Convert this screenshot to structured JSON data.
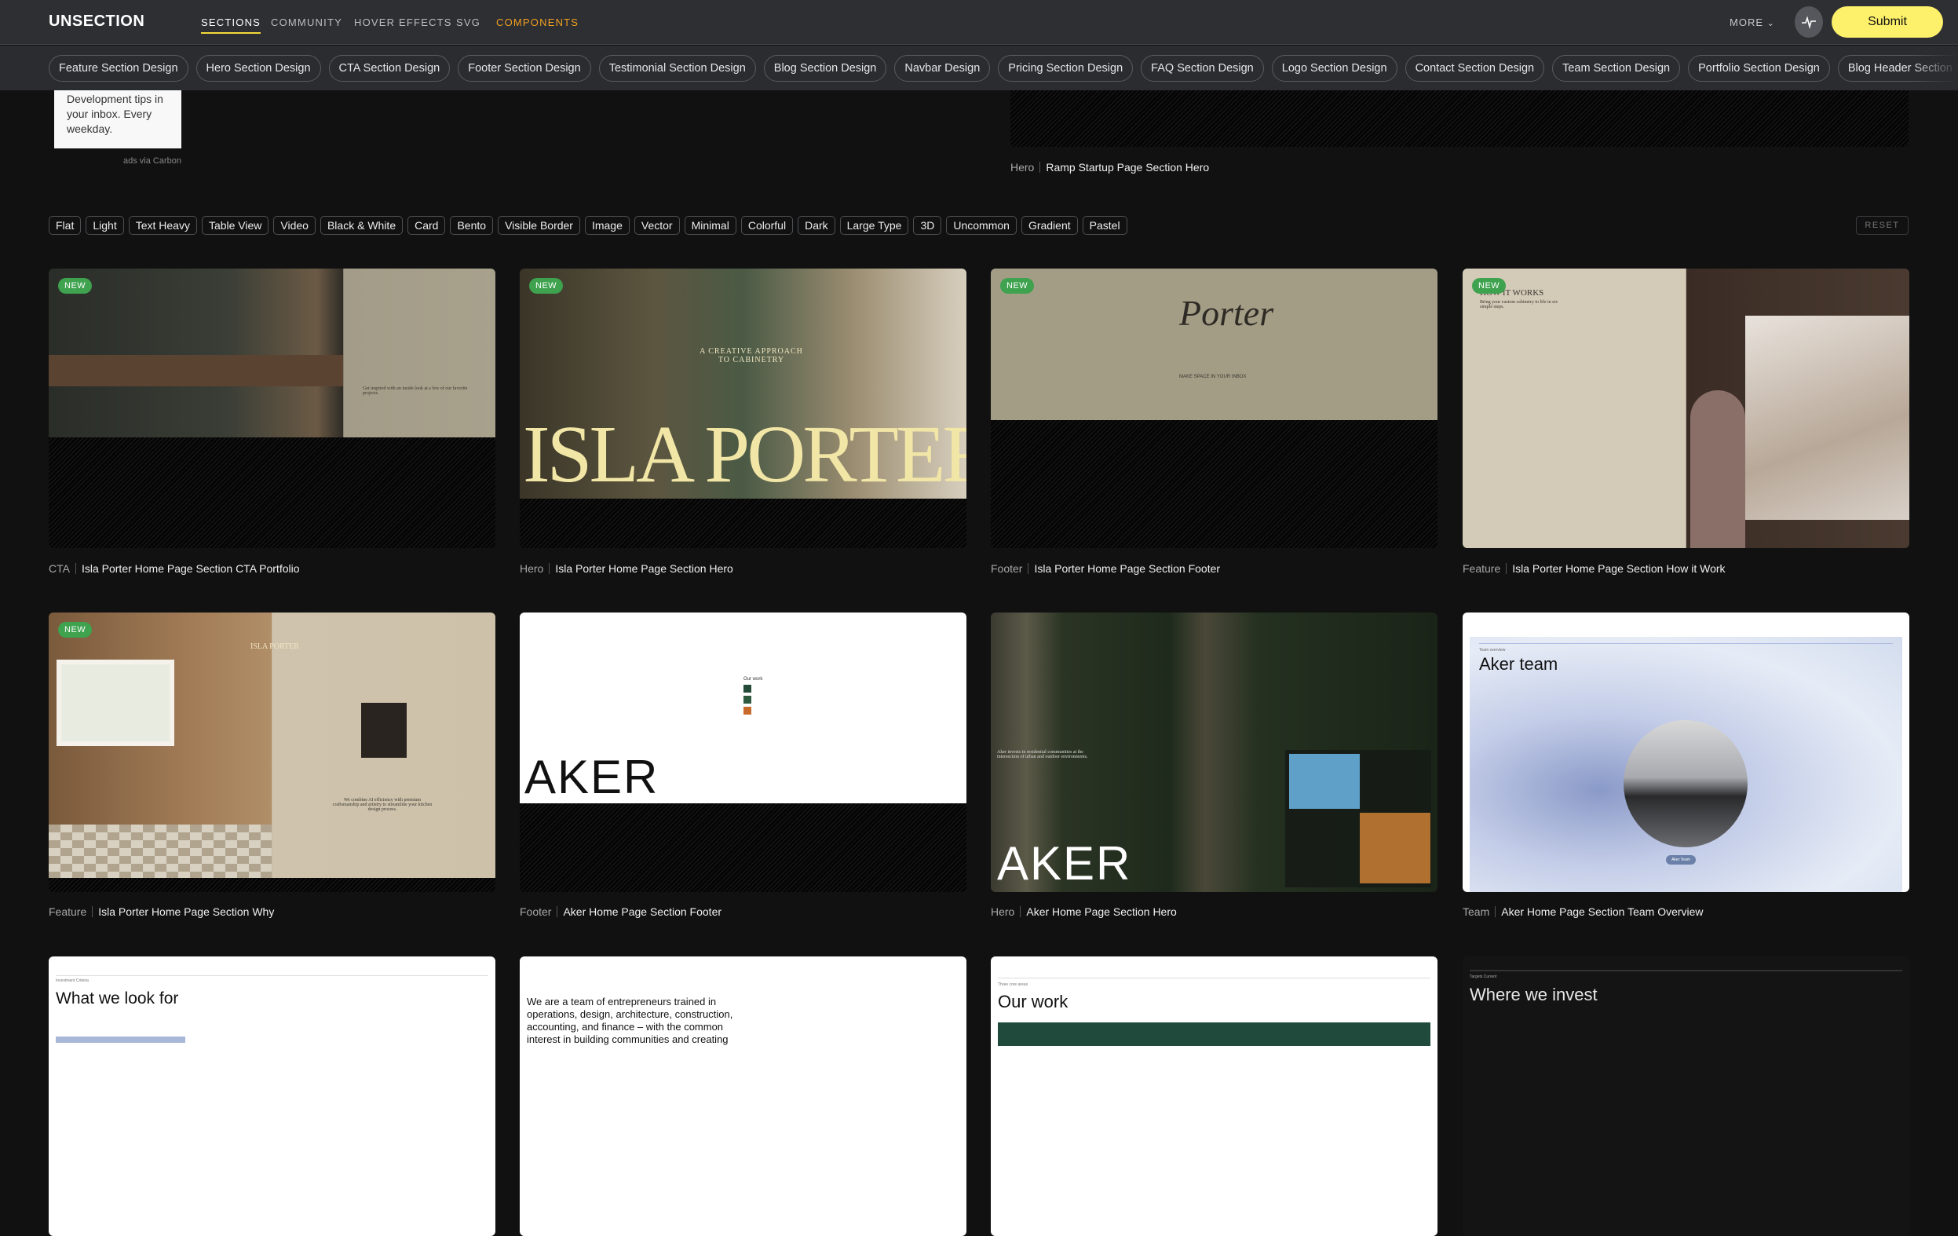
{
  "header": {
    "logo": "UNSECTION",
    "nav": [
      {
        "label": "SECTIONS",
        "active": true
      },
      {
        "label": "COMMUNITY"
      },
      {
        "label": "HOVER EFFECTS"
      },
      {
        "label": "SVG"
      },
      {
        "label": "COMPONENTS",
        "color": "#f0a020"
      }
    ],
    "more_label": "MORE",
    "activity_icon": "pulse-icon",
    "submit_label": "Submit",
    "submit_color": "#fdf06a"
  },
  "categories": [
    "Feature Section Design",
    "Hero Section Design",
    "CTA Section Design",
    "Footer Section Design",
    "Testimonial Section Design",
    "Blog Section Design",
    "Navbar Design",
    "Pricing Section Design",
    "FAQ Section Design",
    "Logo Section Design",
    "Contact Section Design",
    "Team Section Design",
    "Portfolio Section Design",
    "Blog Header Section Design"
  ],
  "ad": {
    "text": "Development tips in your inbox. Every weekday.",
    "note": "ads via Carbon"
  },
  "top_item": {
    "category": "Hero",
    "title": "Ramp Startup Page Section Hero"
  },
  "filters": [
    "Flat",
    "Light",
    "Text Heavy",
    "Table View",
    "Video",
    "Black & White",
    "Card",
    "Bento",
    "Visible Border",
    "Image",
    "Vector",
    "Minimal",
    "Colorful",
    "Dark",
    "Large Type",
    "3D",
    "Uncommon",
    "Gradient",
    "Pastel"
  ],
  "reset_label": "RESET",
  "badge_label": "NEW",
  "cards": [
    {
      "category": "CTA",
      "title": "Isla Porter Home Page Section CTA Portfolio",
      "new": true,
      "thumb_text": "Get inspired with an inside look at a few of our favorite projects."
    },
    {
      "category": "Hero",
      "title": "Isla Porter Home Page Section Hero",
      "new": true,
      "thumb_text": "ISLA PORTER",
      "thumb_sub": "A CREATIVE APPROACH TO CABINETRY"
    },
    {
      "category": "Footer",
      "title": "Isla Porter Home Page Section Footer",
      "new": true,
      "thumb_text": "Porter",
      "thumb_sub": "MAKE SPACE IN YOUR INBOX"
    },
    {
      "category": "Feature",
      "title": "Isla Porter Home Page Section How it Work",
      "new": true,
      "thumb_text": "HOW IT WORKS",
      "thumb_sub": "Bring your custom cabinetry to life in six simple steps."
    },
    {
      "category": "Feature",
      "title": "Isla Porter Home Page Section Why",
      "new": true,
      "thumb_text": "ISLA PORTER",
      "thumb_sub": "We combine AI efficiency with premium craftsmanship and artistry to streamline your kitchen design process."
    },
    {
      "category": "Footer",
      "title": "Aker Home Page Section Footer",
      "new": false,
      "thumb_text": "AKER",
      "thumb_sub": "Our work"
    },
    {
      "category": "Hero",
      "title": "Aker Home Page Section Hero",
      "new": false,
      "thumb_text": "AKER",
      "thumb_sub": "Aker invests in residential communities at the intersection of urban and outdoor environments."
    },
    {
      "category": "Team",
      "title": "Aker Home Page Section Team Overview",
      "new": false,
      "thumb_text": "Aker team",
      "thumb_sub": "Team overview",
      "thumb_button": "Aker Team"
    },
    {
      "thumb_text": "What we look for",
      "thumb_sub": "Investment Criteria"
    },
    {
      "thumb_text": "We are a team of entrepreneurs trained in operations, design, architecture, construction, accounting, and finance – with the common interest in building communities and creating"
    },
    {
      "thumb_text": "Our work",
      "thumb_sub": "Three core areas"
    },
    {
      "thumb_text": "Where we invest",
      "thumb_sub": "Targets  Current"
    }
  ]
}
